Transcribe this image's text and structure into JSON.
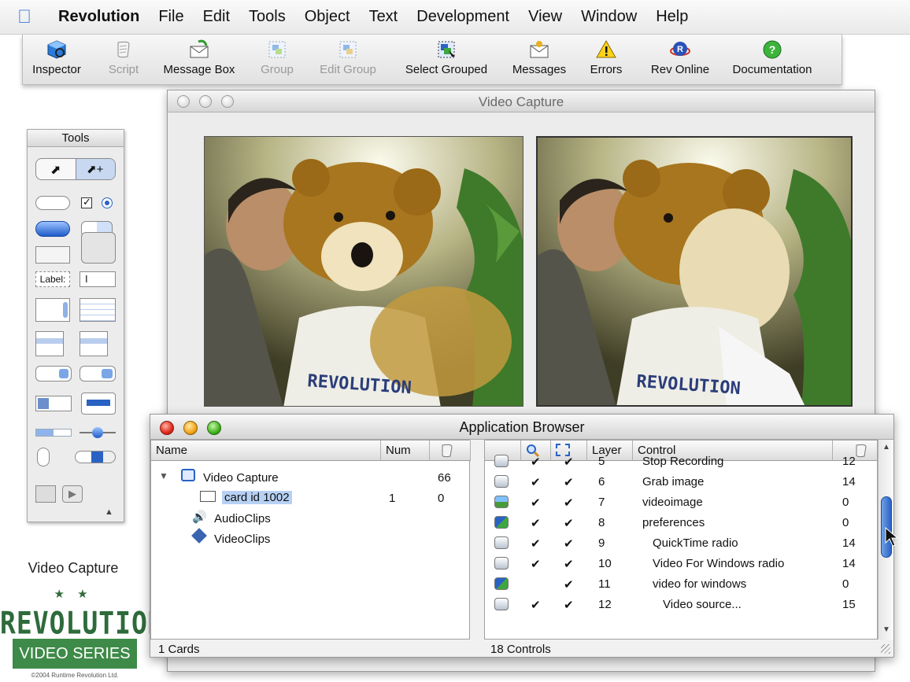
{
  "menubar": {
    "app_name": "Revolution",
    "items": [
      "File",
      "Edit",
      "Tools",
      "Object",
      "Text",
      "Development",
      "View",
      "Window",
      "Help"
    ]
  },
  "toolbar": {
    "buttons": [
      {
        "label": "Inspector",
        "icon": "inspector-cube-icon",
        "enabled": true
      },
      {
        "label": "Script",
        "icon": "script-scroll-icon",
        "enabled": false
      },
      {
        "label": "Message Box",
        "icon": "message-envelope-icon",
        "enabled": true
      },
      {
        "label": "Group",
        "icon": "group-icon",
        "enabled": false
      },
      {
        "label": "Edit Group",
        "icon": "edit-group-icon",
        "enabled": false
      },
      {
        "label": "Select Grouped",
        "icon": "select-grouped-icon",
        "enabled": true
      },
      {
        "label": "Messages",
        "icon": "messages-envelope-icon",
        "enabled": true
      },
      {
        "label": "Errors",
        "icon": "warning-triangle-icon",
        "enabled": true
      },
      {
        "label": "Rev Online",
        "icon": "rev-online-globe-icon",
        "enabled": true
      },
      {
        "label": "Documentation",
        "icon": "help-question-icon",
        "enabled": true
      }
    ]
  },
  "tools_palette": {
    "title": "Tools",
    "label_tool_text": "Label:"
  },
  "brand": {
    "caption": "Video Capture",
    "stars": "★ ★",
    "word": "REVOLUTION",
    "series": "VIDEO SERIES",
    "copyright": "©2004 Runtime Revolution Ltd."
  },
  "video_window": {
    "title": "Video Capture"
  },
  "app_browser": {
    "title": "Application Browser",
    "left_headers": {
      "name": "Name",
      "num": "Num"
    },
    "tree": [
      {
        "name": "Video Capture",
        "num": "",
        "count": "66",
        "icon": "stack-window-icon",
        "expanded": true,
        "indent": 0
      },
      {
        "name": "card id 1002",
        "num": "1",
        "count": "0",
        "icon": "card-icon",
        "selected": true,
        "indent": 1
      },
      {
        "name": "AudioClips",
        "num": "",
        "count": "",
        "icon": "audio-clips-icon",
        "indent": 0
      },
      {
        "name": "VideoClips",
        "num": "",
        "count": "",
        "icon": "video-clips-icon",
        "indent": 0
      }
    ],
    "right_headers": {
      "layer": "Layer",
      "control": "Control"
    },
    "controls": [
      {
        "layer": "5",
        "name": "Stop Recording",
        "count": "12",
        "icon": "button-icon",
        "visible": true,
        "selectable": true,
        "indent": 0
      },
      {
        "layer": "6",
        "name": "Grab image",
        "count": "14",
        "icon": "button-icon",
        "visible": true,
        "selectable": true,
        "indent": 0
      },
      {
        "layer": "7",
        "name": "videoimage",
        "count": "0",
        "icon": "image-icon",
        "visible": true,
        "selectable": true,
        "indent": 0
      },
      {
        "layer": "8",
        "name": "preferences",
        "count": "0",
        "icon": "group-control-icon",
        "visible": true,
        "selectable": true,
        "indent": 0
      },
      {
        "layer": "9",
        "name": "QuickTime radio",
        "count": "14",
        "icon": "button-icon",
        "visible": true,
        "selectable": true,
        "indent": 1
      },
      {
        "layer": "10",
        "name": "Video For Windows radio",
        "count": "14",
        "icon": "button-icon",
        "visible": true,
        "selectable": true,
        "indent": 1
      },
      {
        "layer": "11",
        "name": "video for windows",
        "count": "0",
        "icon": "group-control-icon",
        "visible": false,
        "selectable": true,
        "indent": 1
      },
      {
        "layer": "12",
        "name": "Video source...",
        "count": "15",
        "icon": "button-icon",
        "visible": true,
        "selectable": true,
        "indent": 2
      }
    ],
    "status_left": "1 Cards",
    "status_right": "18 Controls"
  }
}
